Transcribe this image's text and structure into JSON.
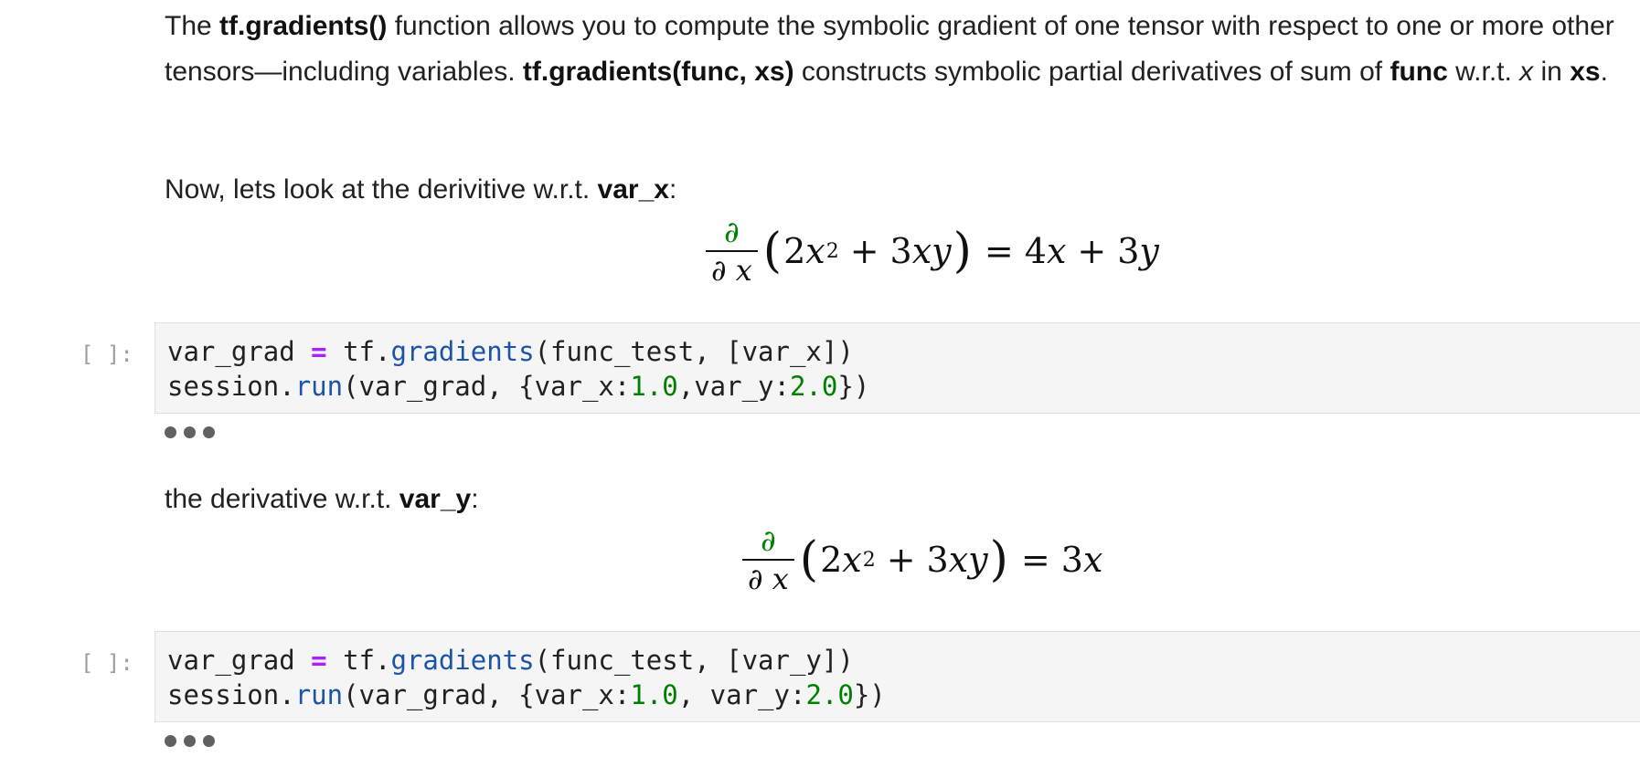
{
  "markdown_intro": {
    "t1": "The ",
    "b1": "tf.gradients()",
    "t2": " function allows you to compute the symbolic gradient of one tensor with respect to one or more other tensors—including variables. ",
    "b2": "tf.gradients(func, xs)",
    "t3": " constructs symbolic partial derivatives of sum of ",
    "b3": "func",
    "t4": " w.r.t. ",
    "i1": "x",
    "t5": " in ",
    "b4": "xs",
    "t6": "."
  },
  "markdown_x": {
    "t1": "Now, lets look at the derivitive w.r.t. ",
    "b1": "var_x",
    "t2": ":"
  },
  "equation_x": {
    "partial": "∂",
    "den": "∂ x",
    "c1": "2",
    "v1": "x",
    "exp": "2",
    "plus": "+",
    "c2": "3",
    "v2": "xy",
    "eq": "=",
    "r1": "4",
    "rv1": "x",
    "rplus": "+",
    "r2": "3",
    "rv2": "y"
  },
  "code_cell_1": {
    "prompt": "[ ]:",
    "l1_a": "var_grad ",
    "l1_op": "=",
    "l1_b": " tf.",
    "l1_fn": "gradients",
    "l1_c": "(func_test, [var_x])",
    "l2_a": "session.",
    "l2_fn": "run",
    "l2_b": "(var_grad, {var_x:",
    "l2_n1": "1.0",
    "l2_c": ",var_y:",
    "l2_n2": "2.0",
    "l2_d": "})"
  },
  "markdown_y": {
    "t1": "the derivative w.r.t. ",
    "b1": "var_y",
    "t2": ":"
  },
  "equation_y": {
    "partial": "∂",
    "den": "∂ x",
    "c1": "2",
    "v1": "x",
    "exp": "2",
    "plus": "+",
    "c2": "3",
    "v2": "xy",
    "eq": "=",
    "r1": "3",
    "rv1": "x"
  },
  "code_cell_2": {
    "prompt": "[ ]:",
    "l1_a": "var_grad ",
    "l1_op": "=",
    "l1_b": " tf.",
    "l1_fn": "gradients",
    "l1_c": "(func_test, [var_y])",
    "l2_a": "session.",
    "l2_fn": "run",
    "l2_b": "(var_grad, {var_x:",
    "l2_n1": "1.0",
    "l2_c": ", var_y:",
    "l2_n2": "2.0",
    "l2_d": "})"
  },
  "colors": {
    "keyword_op": "#aa22ff",
    "function": "#1a55a8",
    "number": "#008000",
    "editor_bg": "#f5f5f5"
  },
  "icons": {
    "output_collapsed": "ellipsis-icon"
  }
}
